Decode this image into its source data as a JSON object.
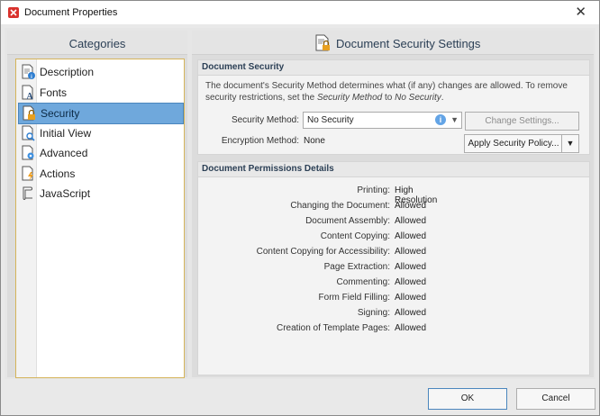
{
  "window": {
    "title": "Document Properties"
  },
  "categories": {
    "title": "Categories",
    "items": [
      {
        "label": "Description",
        "icon": "description-icon"
      },
      {
        "label": "Fonts",
        "icon": "fonts-icon"
      },
      {
        "label": "Security",
        "icon": "security-icon",
        "selected": true
      },
      {
        "label": "Initial View",
        "icon": "initial-view-icon"
      },
      {
        "label": "Advanced",
        "icon": "advanced-icon"
      },
      {
        "label": "Actions",
        "icon": "actions-icon"
      },
      {
        "label": "JavaScript",
        "icon": "javascript-icon"
      }
    ]
  },
  "main": {
    "title": "Document Security Settings",
    "security": {
      "header": "Document Security",
      "description_1": "The document's Security Method determines what (if any) changes are allowed. To remove",
      "description_2": "security restrictions, set the ",
      "description_italic": "Security Method",
      "description_3": " to ",
      "description_italic2": "No Security",
      "description_4": ".",
      "method_label": "Security Method:",
      "method_value": "No Security",
      "encryption_label": "Encryption Method:",
      "encryption_value": "None",
      "change_settings": "Change Settings...",
      "apply_policy": "Apply Security Policy..."
    },
    "permissions": {
      "header": "Document Permissions Details",
      "rows": [
        {
          "label": "Printing:",
          "value": "High Resolution"
        },
        {
          "label": "Changing the Document:",
          "value": "Allowed"
        },
        {
          "label": "Document Assembly:",
          "value": "Allowed"
        },
        {
          "label": "Content Copying:",
          "value": "Allowed"
        },
        {
          "label": "Content Copying for Accessibility:",
          "value": "Allowed"
        },
        {
          "label": "Page Extraction:",
          "value": "Allowed"
        },
        {
          "label": "Commenting:",
          "value": "Allowed"
        },
        {
          "label": "Form Field Filling:",
          "value": "Allowed"
        },
        {
          "label": "Signing:",
          "value": "Allowed"
        },
        {
          "label": "Creation of Template Pages:",
          "value": "Allowed"
        }
      ]
    }
  },
  "footer": {
    "ok": "OK",
    "cancel": "Cancel"
  },
  "colors": {
    "selection": "#6fa8dc",
    "accent": "#2b3f55",
    "list_border": "#d5b45a"
  }
}
